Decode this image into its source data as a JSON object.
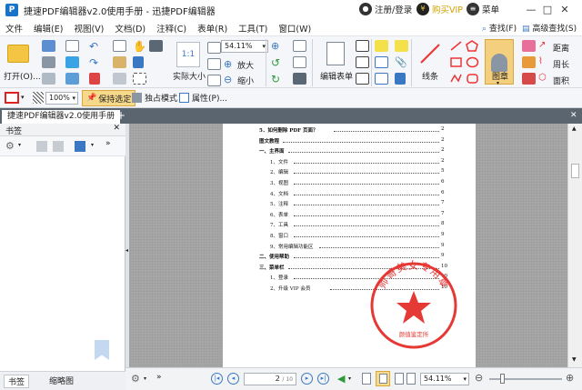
{
  "window": {
    "title": "捷速PDF编辑器v2.0使用手册 - 迅捷PDF编辑器",
    "app_icon_letter": "P",
    "login_label": "注册/登录",
    "buy_vip_label": "购买VIP",
    "menu_label": "菜单"
  },
  "menu": [
    "文件",
    "编辑(E)",
    "视图(V)",
    "文档(D)",
    "注释(C)",
    "表单(R)",
    "工具(T)",
    "窗口(W)"
  ],
  "search": {
    "find_label": "查找(F)",
    "advanced_find_label": "高级查找(S)"
  },
  "toolbar": {
    "open_label": "打开(O)...",
    "actual_size_label": "实际大小",
    "actual_size_glyph": "1:1",
    "zoom_value": "54.11%",
    "zoom_in_label": "放大",
    "zoom_out_label": "缩小",
    "edit_form_label": "编辑表单",
    "line_label": "线条",
    "stamp_label": "图章",
    "distance_label": "距离",
    "perimeter_label": "周长",
    "area_label": "面积"
  },
  "toolbar2": {
    "line_width_value": "100%",
    "keep_selected_label": "保持选定",
    "exclusive_mode_label": "独占模式",
    "properties_label": "属性(P)..."
  },
  "tab": {
    "document_tab_label": "捷速PDF编辑器v2.0使用手册"
  },
  "sidebar": {
    "title": "书签",
    "tabs": [
      "书签",
      "缩略图"
    ]
  },
  "document": {
    "toc": [
      {
        "text": "5．如何删除 PDF 页面？",
        "page": "2",
        "level": 1
      },
      {
        "text": "图文教程",
        "page": "2",
        "level": 0
      },
      {
        "text": "一、主界面",
        "page": "2",
        "level": 0
      },
      {
        "text": "1、文件",
        "page": "2",
        "level": 2
      },
      {
        "text": "2、编辑",
        "page": "5",
        "level": 2
      },
      {
        "text": "3、视图",
        "page": "6",
        "level": 2
      },
      {
        "text": "4、文档",
        "page": "6",
        "level": 2
      },
      {
        "text": "5、注释",
        "page": "7",
        "level": 2
      },
      {
        "text": "6、表单",
        "page": "7",
        "level": 2
      },
      {
        "text": "7、工具",
        "page": "8",
        "level": 2
      },
      {
        "text": "8、窗口",
        "page": "9",
        "level": 2
      },
      {
        "text": "9、常用编辑功能区",
        "page": "9",
        "level": 2
      },
      {
        "text": "二、使用帮助",
        "page": "9",
        "level": 0
      },
      {
        "text": "三、菜单栏",
        "page": "10",
        "level": 0
      },
      {
        "text": "1、登录",
        "page": "10",
        "level": 2
      },
      {
        "text": "2、升级 VIP 会员",
        "page": "10",
        "level": 2
      }
    ],
    "seal_text": "帅哥美女专用章",
    "seal_bottom_text": "颜值鉴定所"
  },
  "statusbar": {
    "current_page": "2",
    "total_pages": "/ 10",
    "zoom_value": "54.11%"
  },
  "colors": {
    "accent": "#1a73c7",
    "stamp_red": "#e53935",
    "tab_bar": "#5b6570"
  }
}
